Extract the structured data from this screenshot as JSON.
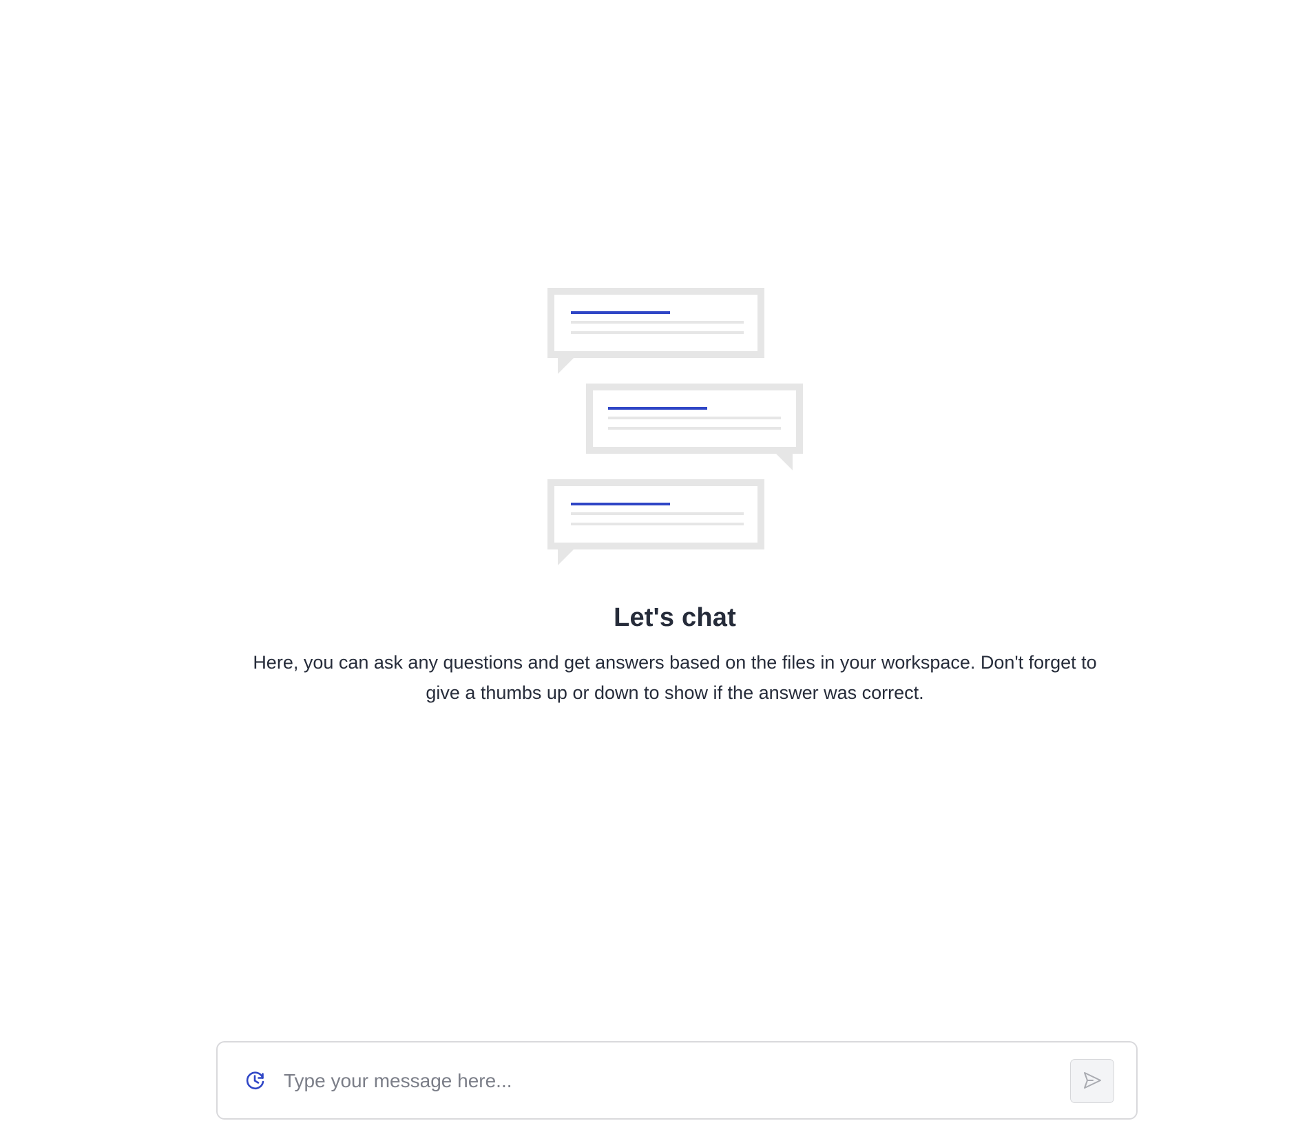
{
  "empty_state": {
    "title": "Let's chat",
    "description": "Here, you can ask any questions and get answers based on the files in your workspace. Don't forget to give a thumbs up or down to show if the answer was correct.",
    "illustration_icon": "chat-bubbles-illustration"
  },
  "composer": {
    "placeholder": "Type your message here...",
    "value": "",
    "history_icon": "history-icon",
    "send_icon": "send-icon"
  },
  "colors": {
    "accent": "#2f46c6",
    "bubble_gray": "#e6e6e6",
    "text_dark": "#262c3a",
    "placeholder": "#7b7e88",
    "border": "#d9d9dc",
    "send_bg": "#f3f4f6"
  }
}
